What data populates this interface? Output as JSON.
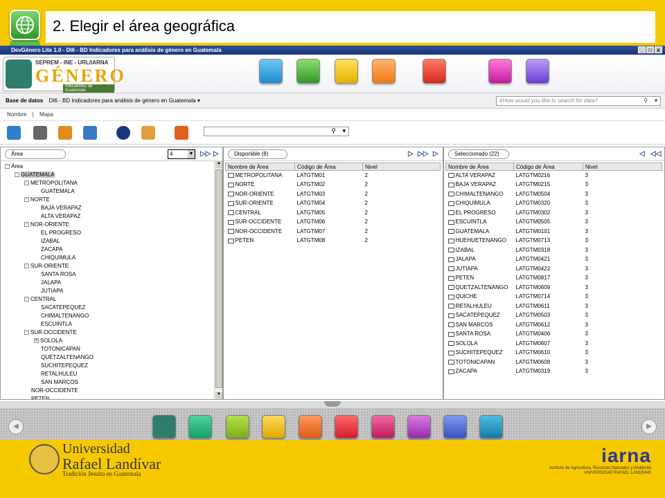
{
  "slide": {
    "title": "2. Elegir el área geográfica"
  },
  "window": {
    "title": "DevGénero Lite 1.0 - DI6 - BD Indicadores para análisis de género en Guatemala",
    "controls": [
      "_",
      "□",
      "x"
    ]
  },
  "logo": {
    "org": "SEPREM - INE - URL/IARNA",
    "name": "GÉNERO",
    "subtitle": "Indicadores de Guatemala"
  },
  "menubar": {
    "db_label": "Base de datos",
    "db_value": "DI6 - BD Indicadores para análisis de género en Guatemala",
    "search_placeholder": "#How would you like to search for data?"
  },
  "tabs": [
    "Nombre",
    "|",
    "Mapa"
  ],
  "left_pane": {
    "label": "Área",
    "level_value": "4",
    "tree": [
      {
        "label": "Área",
        "indent": 0,
        "exp": "-"
      },
      {
        "label": "GUATEMALA",
        "indent": 1,
        "exp": "-",
        "selected": true
      },
      {
        "label": "METROPOLITANA",
        "indent": 2,
        "exp": "-"
      },
      {
        "label": "GUATEMALA",
        "indent": 3,
        "exp": ""
      },
      {
        "label": "NORTE",
        "indent": 2,
        "exp": "-"
      },
      {
        "label": "BAJA VERAPAZ",
        "indent": 3,
        "exp": ""
      },
      {
        "label": "ALTA VERAPAZ",
        "indent": 3,
        "exp": ""
      },
      {
        "label": "NOR-ORIENTE",
        "indent": 2,
        "exp": "-"
      },
      {
        "label": "EL PROGRESO",
        "indent": 3,
        "exp": ""
      },
      {
        "label": "IZABAL",
        "indent": 3,
        "exp": ""
      },
      {
        "label": "ZACAPA",
        "indent": 3,
        "exp": ""
      },
      {
        "label": "CHIQUIMULA",
        "indent": 3,
        "exp": ""
      },
      {
        "label": "SUR-ORIENTE",
        "indent": 2,
        "exp": "-"
      },
      {
        "label": "SANTA ROSA",
        "indent": 3,
        "exp": ""
      },
      {
        "label": "JALAPA",
        "indent": 3,
        "exp": ""
      },
      {
        "label": "JUTIAPA",
        "indent": 3,
        "exp": ""
      },
      {
        "label": "CENTRAL",
        "indent": 2,
        "exp": "-"
      },
      {
        "label": "SACATEPEQUEZ",
        "indent": 3,
        "exp": ""
      },
      {
        "label": "CHIMALTENANGO",
        "indent": 3,
        "exp": ""
      },
      {
        "label": "ESCUINTLA",
        "indent": 3,
        "exp": ""
      },
      {
        "label": "SUR-OCCIDENTE",
        "indent": 2,
        "exp": "-"
      },
      {
        "label": "SOLOLA",
        "indent": 3,
        "exp": "+"
      },
      {
        "label": "TOTONICAPAN",
        "indent": 3,
        "exp": ""
      },
      {
        "label": "QUETZALTENANGO",
        "indent": 3,
        "exp": ""
      },
      {
        "label": "SUCHITEPEQUEZ",
        "indent": 3,
        "exp": ""
      },
      {
        "label": "RETALHULEU",
        "indent": 3,
        "exp": ""
      },
      {
        "label": "SAN MARCOS",
        "indent": 3,
        "exp": ""
      },
      {
        "label": "NOR-OCCIDENTE",
        "indent": 2,
        "exp": ""
      },
      {
        "label": "PETEN",
        "indent": 2,
        "exp": ""
      }
    ]
  },
  "available": {
    "label": "Disponible (8)",
    "columns": [
      "Nombre de Área",
      "Código de Área",
      "Nivel"
    ],
    "rows": [
      [
        "METROPOLITANA",
        "LATGTM01",
        "2"
      ],
      [
        "NORTE",
        "LATGTM02",
        "2"
      ],
      [
        "NOR-ORIENTE",
        "LATGTM03",
        "2"
      ],
      [
        "SUR-ORIENTE",
        "LATGTM04",
        "2"
      ],
      [
        "CENTRAL",
        "LATGTM05",
        "2"
      ],
      [
        "SUR-OCCIDENTE",
        "LATGTM06",
        "2"
      ],
      [
        "NOR-OCCIDENTE",
        "LATGTM07",
        "2"
      ],
      [
        "PETEN",
        "LATGTM08",
        "2"
      ]
    ]
  },
  "selected": {
    "label": "Seleccionado (22)",
    "columns": [
      "Nombre de Área",
      "Código de Área",
      "Nivel"
    ],
    "rows": [
      [
        "ALTA VERAPAZ",
        "LATGTM0216",
        "3"
      ],
      [
        "BAJA VERAPAZ",
        "LATGTM0215",
        "3"
      ],
      [
        "CHIMALTENANGO",
        "LATGTM0504",
        "3"
      ],
      [
        "CHIQUIMULA",
        "LATGTM0320",
        "3"
      ],
      [
        "EL PROGRESO",
        "LATGTM0302",
        "3"
      ],
      [
        "ESCUINTLA",
        "LATGTM0505",
        "3"
      ],
      [
        "GUATEMALA",
        "LATGTM0101",
        "3"
      ],
      [
        "HUEHUETENANGO",
        "LATGTM0713",
        "3"
      ],
      [
        "IZABAL",
        "LATGTM0318",
        "3"
      ],
      [
        "JALAPA",
        "LATGTM0421",
        "3"
      ],
      [
        "JUTIAPA",
        "LATGTM0422",
        "3"
      ],
      [
        "PETEN",
        "LATGTM0817",
        "3"
      ],
      [
        "QUETZALTENANGO",
        "LATGTM0609",
        "3"
      ],
      [
        "QUICHE",
        "LATGTM0714",
        "3"
      ],
      [
        "RETALHULEU",
        "LATGTM0611",
        "3"
      ],
      [
        "SACATEPEQUEZ",
        "LATGTM0503",
        "3"
      ],
      [
        "SAN MARCOS",
        "LATGTM0612",
        "3"
      ],
      [
        "SANTA ROSA",
        "LATGTM0406",
        "3"
      ],
      [
        "SOLOLA",
        "LATGTM0607",
        "3"
      ],
      [
        "SUCHITEPEQUEZ",
        "LATGTM0610",
        "3"
      ],
      [
        "TOTONICAPAN",
        "LATGTM0608",
        "3"
      ],
      [
        "ZACAPA",
        "LATGTM0319",
        "3"
      ]
    ]
  },
  "footer": {
    "url_line1": "Universidad",
    "url_line2": "Rafael Landívar",
    "url_line3": "Tradición Jesuita en Guatemala",
    "iarna_name": "iarna",
    "iarna_line1": "Instituto de Agricultura, Recursos Naturales y Ambiente",
    "iarna_line2": "UNIVERSIDAD RAFAEL LANDÍVAR"
  },
  "colors": {
    "slide_yellow": "#f6c800",
    "titlebar_blue": "#1b3678"
  }
}
